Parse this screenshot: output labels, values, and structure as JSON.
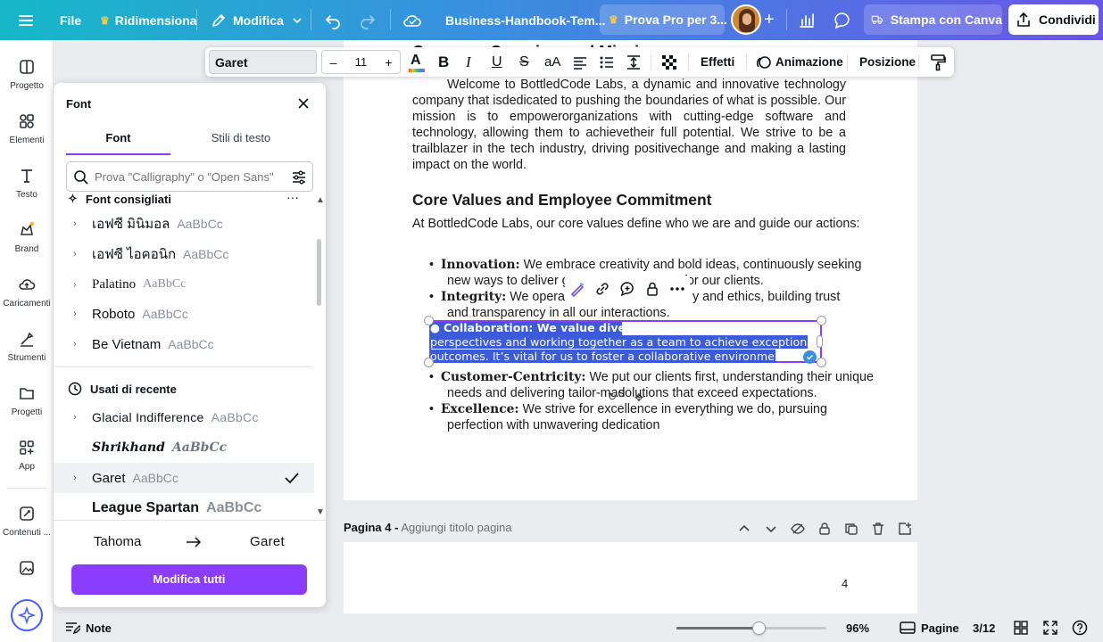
{
  "topbar": {
    "file": "File",
    "resize": "Ridimensiona",
    "edit": "Modifica",
    "doc_title": "Business-Handbook-Tem...",
    "try_pro": "Prova Pro per 3...",
    "print": "Stampa con Canva",
    "share": "Condividi"
  },
  "rail": {
    "items": [
      "Progetto",
      "Elementi",
      "Testo",
      "Brand",
      "Caricamenti",
      "Strumenti",
      "Progetti",
      "App",
      "Contenuti ..."
    ]
  },
  "toolbar": {
    "font_name": "Garet",
    "font_size": "11",
    "minus": "–",
    "plus": "+",
    "effects": "Effetti",
    "animation": "Animazione",
    "position": "Posizione"
  },
  "panel": {
    "title": "Font",
    "tab_font": "Font",
    "tab_styles": "Stili di testo",
    "search_placeholder": "Prova \"Calligraphy\" o \"Open Sans\"",
    "recommended_heading": "Font consigliati",
    "recommended": [
      {
        "name": "เอฟซี มินิมอล",
        "sample": "AaBbCc"
      },
      {
        "name": "เอฟซี ไอคอนิก",
        "sample": "AaBbCc"
      },
      {
        "name": "Palatino",
        "sample": "AaBbCc"
      },
      {
        "name": "Roboto",
        "sample": "AaBbCc"
      },
      {
        "name": "Be Vietnam",
        "sample": "AaBbCc"
      }
    ],
    "recent_heading": "Usati di recente",
    "recent": [
      {
        "name": "Glacial Indifference",
        "sample": "AaBbCc"
      },
      {
        "name": "Shrikhand",
        "sample": "AaBbCc"
      },
      {
        "name": "Garet",
        "sample": "AaBbCc"
      },
      {
        "name": "League Spartan",
        "sample": "AaBbCc"
      }
    ],
    "replace_from": "Tahoma",
    "replace_to": "Garet",
    "edit_all": "Modifica tutti"
  },
  "document": {
    "intro": "Welcome to BottledCode Labs, a dynamic and innovative technology company that isdedicated to pushing the boundaries of what is possible. Our mission is to empowerorganizations with cutting-edge software and technology, allowing them to achievetheir full potential. We strive to be a trailblazer in the tech industry, driving positivechange and making a lasting impact on the world.",
    "heading": "Core Values and Employee Commitment",
    "lead": "At BottledCode Labs, our core values define who we are and guide our actions:",
    "innovation_term": "Innovation:",
    "innovation_text_1": "We embrace creativity and bold ideas, continuously seeking",
    "innovation_text_2": "new ways to deliver gro",
    "innovation_text_3": "for our clients.",
    "integrity_term": "Integrity:",
    "integrity_text_1": "We operate w",
    "integrity_text_2": "y and ethics, building trust",
    "integrity_text_3": "and transparency in all our interactions.",
    "collab_line_1": "Collaboration: We value diverse",
    "collab_line_2": "perspectives and working together as a team to achieve exceptional",
    "collab_line_3": "outcomes. It’s vital for us to foster a collaborative environment.",
    "customer_term": "Customer-Centricity:",
    "customer_text_1": "We put our clients first, understanding their unique",
    "customer_text_2": "needs and delivering tailor-mad",
    "customer_text_3": "solutions that exceed expectations.",
    "excellence_term": "Excellence:",
    "excellence_text_1": "We strive for excellence in everything we do, pursuing",
    "excellence_text_2": "perfection with unwavering dedication"
  },
  "page4": {
    "label": "Pagina 4 -",
    "title_placeholder": "Aggiungi titolo pagina",
    "number": "4"
  },
  "bottom": {
    "notes": "Note",
    "zoom": "96%",
    "zoom_fraction": 0.55,
    "pages": "Pagine",
    "page_counter": "3/12"
  },
  "colors": {
    "accent": "#8b3dff",
    "selection": "#3b5bdb",
    "gradient_start": "#16b8c8",
    "gradient_end": "#6a55e6"
  }
}
